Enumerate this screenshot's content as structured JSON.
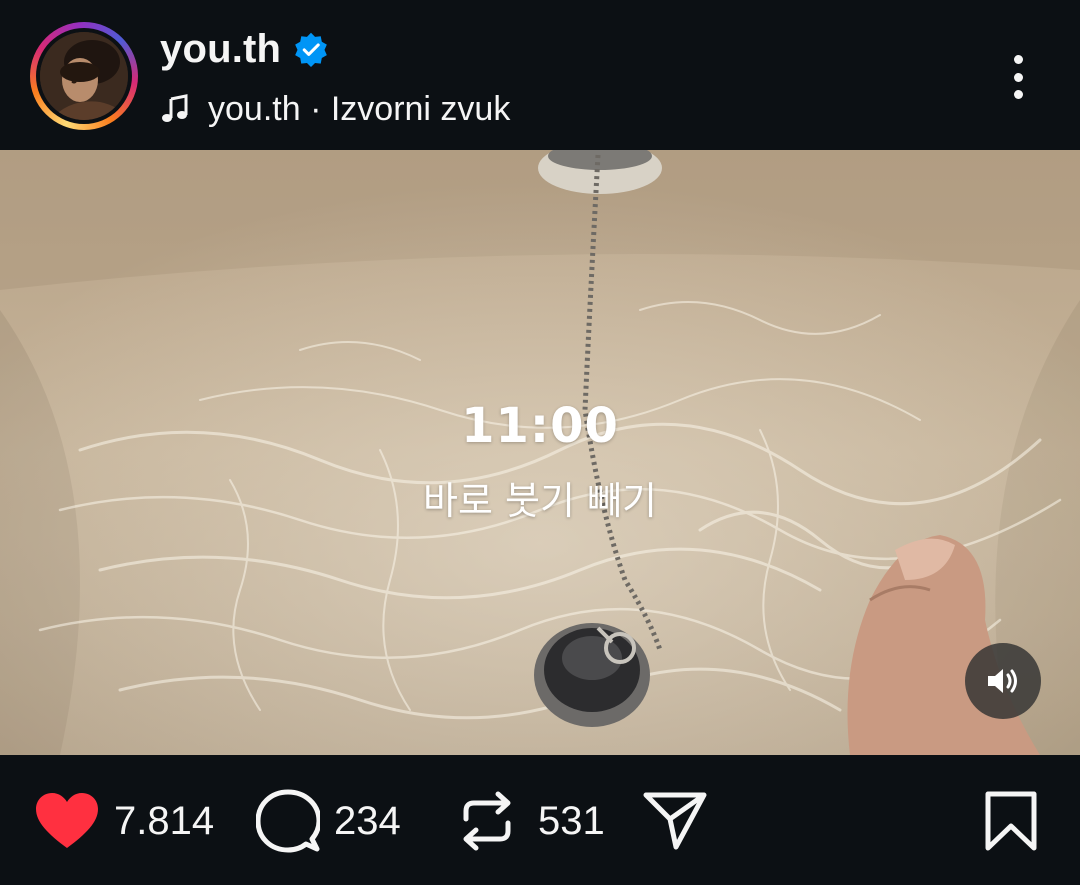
{
  "header": {
    "username": "you.th",
    "verified": true,
    "audio_label": "you.th · Izvorni zvuk",
    "icons": {
      "music": "music-note-icon",
      "verified": "verified-badge-icon",
      "more": "more-vertical-icon"
    }
  },
  "video": {
    "overlay_time": "11:00",
    "overlay_caption": "바로 붓기 빼기",
    "sound_icon": "speaker-on-icon"
  },
  "actions": {
    "likes": "7.814",
    "comments": "234",
    "reposts": "531",
    "icons": {
      "like": "heart-icon",
      "comment": "comment-icon",
      "repost": "repost-icon",
      "share": "send-icon",
      "save": "bookmark-icon"
    }
  },
  "colors": {
    "background": "#0c1014",
    "like": "#ff3040",
    "verified": "#0095f6",
    "text": "#f5f5f5"
  }
}
